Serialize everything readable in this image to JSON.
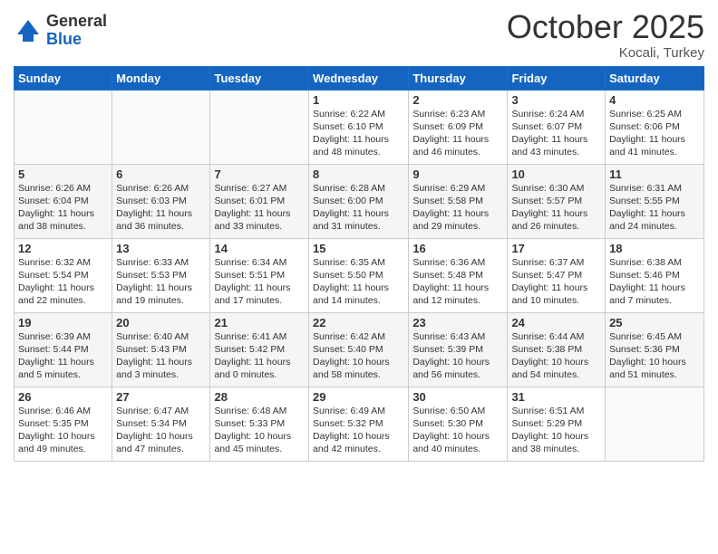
{
  "logo": {
    "general": "General",
    "blue": "Blue"
  },
  "header": {
    "month": "October 2025",
    "location": "Kocali, Turkey"
  },
  "weekdays": [
    "Sunday",
    "Monday",
    "Tuesday",
    "Wednesday",
    "Thursday",
    "Friday",
    "Saturday"
  ],
  "weeks": [
    [
      {
        "day": "",
        "info": ""
      },
      {
        "day": "",
        "info": ""
      },
      {
        "day": "",
        "info": ""
      },
      {
        "day": "1",
        "info": "Sunrise: 6:22 AM\nSunset: 6:10 PM\nDaylight: 11 hours\nand 48 minutes."
      },
      {
        "day": "2",
        "info": "Sunrise: 6:23 AM\nSunset: 6:09 PM\nDaylight: 11 hours\nand 46 minutes."
      },
      {
        "day": "3",
        "info": "Sunrise: 6:24 AM\nSunset: 6:07 PM\nDaylight: 11 hours\nand 43 minutes."
      },
      {
        "day": "4",
        "info": "Sunrise: 6:25 AM\nSunset: 6:06 PM\nDaylight: 11 hours\nand 41 minutes."
      }
    ],
    [
      {
        "day": "5",
        "info": "Sunrise: 6:26 AM\nSunset: 6:04 PM\nDaylight: 11 hours\nand 38 minutes."
      },
      {
        "day": "6",
        "info": "Sunrise: 6:26 AM\nSunset: 6:03 PM\nDaylight: 11 hours\nand 36 minutes."
      },
      {
        "day": "7",
        "info": "Sunrise: 6:27 AM\nSunset: 6:01 PM\nDaylight: 11 hours\nand 33 minutes."
      },
      {
        "day": "8",
        "info": "Sunrise: 6:28 AM\nSunset: 6:00 PM\nDaylight: 11 hours\nand 31 minutes."
      },
      {
        "day": "9",
        "info": "Sunrise: 6:29 AM\nSunset: 5:58 PM\nDaylight: 11 hours\nand 29 minutes."
      },
      {
        "day": "10",
        "info": "Sunrise: 6:30 AM\nSunset: 5:57 PM\nDaylight: 11 hours\nand 26 minutes."
      },
      {
        "day": "11",
        "info": "Sunrise: 6:31 AM\nSunset: 5:55 PM\nDaylight: 11 hours\nand 24 minutes."
      }
    ],
    [
      {
        "day": "12",
        "info": "Sunrise: 6:32 AM\nSunset: 5:54 PM\nDaylight: 11 hours\nand 22 minutes."
      },
      {
        "day": "13",
        "info": "Sunrise: 6:33 AM\nSunset: 5:53 PM\nDaylight: 11 hours\nand 19 minutes."
      },
      {
        "day": "14",
        "info": "Sunrise: 6:34 AM\nSunset: 5:51 PM\nDaylight: 11 hours\nand 17 minutes."
      },
      {
        "day": "15",
        "info": "Sunrise: 6:35 AM\nSunset: 5:50 PM\nDaylight: 11 hours\nand 14 minutes."
      },
      {
        "day": "16",
        "info": "Sunrise: 6:36 AM\nSunset: 5:48 PM\nDaylight: 11 hours\nand 12 minutes."
      },
      {
        "day": "17",
        "info": "Sunrise: 6:37 AM\nSunset: 5:47 PM\nDaylight: 11 hours\nand 10 minutes."
      },
      {
        "day": "18",
        "info": "Sunrise: 6:38 AM\nSunset: 5:46 PM\nDaylight: 11 hours\nand 7 minutes."
      }
    ],
    [
      {
        "day": "19",
        "info": "Sunrise: 6:39 AM\nSunset: 5:44 PM\nDaylight: 11 hours\nand 5 minutes."
      },
      {
        "day": "20",
        "info": "Sunrise: 6:40 AM\nSunset: 5:43 PM\nDaylight: 11 hours\nand 3 minutes."
      },
      {
        "day": "21",
        "info": "Sunrise: 6:41 AM\nSunset: 5:42 PM\nDaylight: 11 hours\nand 0 minutes."
      },
      {
        "day": "22",
        "info": "Sunrise: 6:42 AM\nSunset: 5:40 PM\nDaylight: 10 hours\nand 58 minutes."
      },
      {
        "day": "23",
        "info": "Sunrise: 6:43 AM\nSunset: 5:39 PM\nDaylight: 10 hours\nand 56 minutes."
      },
      {
        "day": "24",
        "info": "Sunrise: 6:44 AM\nSunset: 5:38 PM\nDaylight: 10 hours\nand 54 minutes."
      },
      {
        "day": "25",
        "info": "Sunrise: 6:45 AM\nSunset: 5:36 PM\nDaylight: 10 hours\nand 51 minutes."
      }
    ],
    [
      {
        "day": "26",
        "info": "Sunrise: 6:46 AM\nSunset: 5:35 PM\nDaylight: 10 hours\nand 49 minutes."
      },
      {
        "day": "27",
        "info": "Sunrise: 6:47 AM\nSunset: 5:34 PM\nDaylight: 10 hours\nand 47 minutes."
      },
      {
        "day": "28",
        "info": "Sunrise: 6:48 AM\nSunset: 5:33 PM\nDaylight: 10 hours\nand 45 minutes."
      },
      {
        "day": "29",
        "info": "Sunrise: 6:49 AM\nSunset: 5:32 PM\nDaylight: 10 hours\nand 42 minutes."
      },
      {
        "day": "30",
        "info": "Sunrise: 6:50 AM\nSunset: 5:30 PM\nDaylight: 10 hours\nand 40 minutes."
      },
      {
        "day": "31",
        "info": "Sunrise: 6:51 AM\nSunset: 5:29 PM\nDaylight: 10 hours\nand 38 minutes."
      },
      {
        "day": "",
        "info": ""
      }
    ]
  ]
}
